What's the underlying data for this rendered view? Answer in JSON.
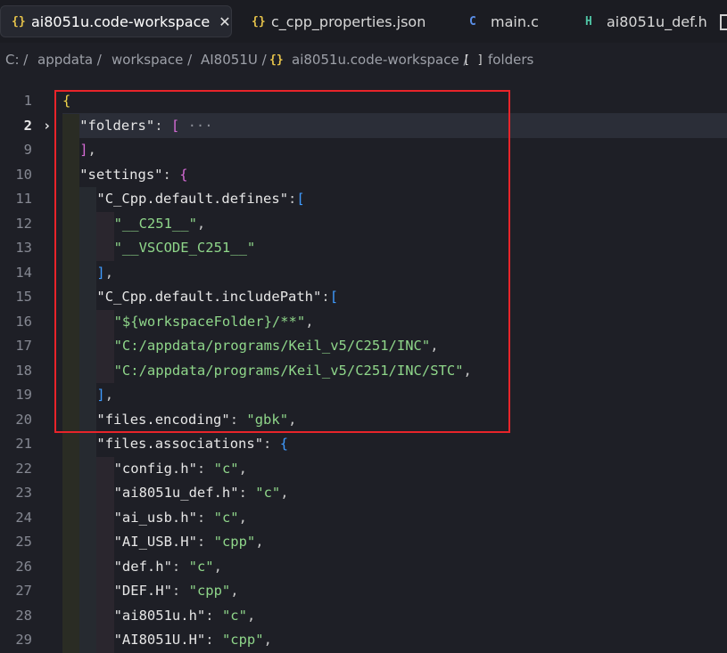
{
  "tabs": [
    {
      "icon": "{}",
      "label": "ai8051u.code-workspace",
      "close": "✕"
    },
    {
      "icon": "{}",
      "label": "c_cpp_properties.json"
    },
    {
      "icon": "C",
      "label": "main.c"
    },
    {
      "icon": "H",
      "label": "ai8051u_def.h"
    }
  ],
  "breadcrumb": [
    "C: /",
    "appdata /",
    "workspace /",
    "AI8051U /",
    "{}",
    "ai8051u.code-workspace /",
    "[ ]",
    "folders"
  ],
  "lines": [
    {
      "num": "1",
      "fold": "",
      "code": "{"
    },
    {
      "num": "2",
      "fold": "›",
      "code": "\"folders\": [ ···"
    },
    {
      "num": "9",
      "fold": "",
      "code": "],"
    },
    {
      "num": "10",
      "fold": "",
      "code": "\"settings\": {"
    },
    {
      "num": "11",
      "fold": "",
      "code": "\"C_Cpp.default.defines\":["
    },
    {
      "num": "12",
      "fold": "",
      "code": "\"__C251__\","
    },
    {
      "num": "13",
      "fold": "",
      "code": "\"__VSCODE_C251__\""
    },
    {
      "num": "14",
      "fold": "",
      "code": "],"
    },
    {
      "num": "15",
      "fold": "",
      "code": "\"C_Cpp.default.includePath\":["
    },
    {
      "num": "16",
      "fold": "",
      "code": "\"${workspaceFolder}/**\","
    },
    {
      "num": "17",
      "fold": "",
      "code": "\"C:/appdata/programs/Keil_v5/C251/INC\","
    },
    {
      "num": "18",
      "fold": "",
      "code": "\"C:/appdata/programs/Keil_v5/C251/INC/STC\","
    },
    {
      "num": "19",
      "fold": "",
      "code": "],"
    },
    {
      "num": "20",
      "fold": "",
      "code": "\"files.encoding\": \"gbk\","
    },
    {
      "num": "21",
      "fold": "",
      "code": "\"files.associations\": {"
    },
    {
      "num": "22",
      "fold": "",
      "code": "\"config.h\": \"c\","
    },
    {
      "num": "23",
      "fold": "",
      "code": "\"ai8051u_def.h\": \"c\","
    },
    {
      "num": "24",
      "fold": "",
      "code": "\"ai_usb.h\": \"c\","
    },
    {
      "num": "25",
      "fold": "",
      "code": "\"AI_USB.H\": \"cpp\","
    },
    {
      "num": "26",
      "fold": "",
      "code": "\"def.h\": \"c\","
    },
    {
      "num": "27",
      "fold": "",
      "code": "\"DEF.H\": \"cpp\","
    },
    {
      "num": "28",
      "fold": "",
      "code": "\"ai8051u.h\": \"c\","
    },
    {
      "num": "29",
      "fold": "",
      "code": "\"AI8051U.H\": \"cpp\","
    }
  ],
  "colors": {
    "string": "#8fd68a",
    "key": "#e6e6e6",
    "brace_outer": "#f1d54b",
    "bracket": "#d66bd6",
    "inner": "#3f9bff",
    "annotation_box": "#e8242a"
  }
}
